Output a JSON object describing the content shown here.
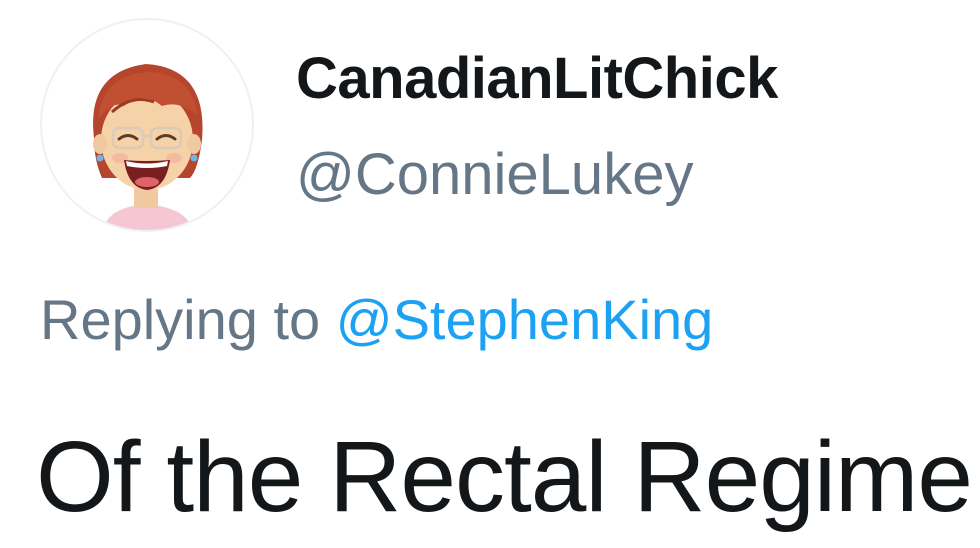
{
  "tweet": {
    "author": {
      "display_name": "CanadianLitChick",
      "handle": "@ConnieLukey",
      "avatar_icon": "bitmoji-laughing-avatar-icon"
    },
    "reply": {
      "prefix": "Replying to",
      "mention": "@StephenKing"
    },
    "text": "Of the Rectal Regime."
  },
  "colors": {
    "primary_text": "#14171a",
    "secondary_text": "#657786",
    "link": "#1da1f2",
    "background": "#ffffff"
  }
}
